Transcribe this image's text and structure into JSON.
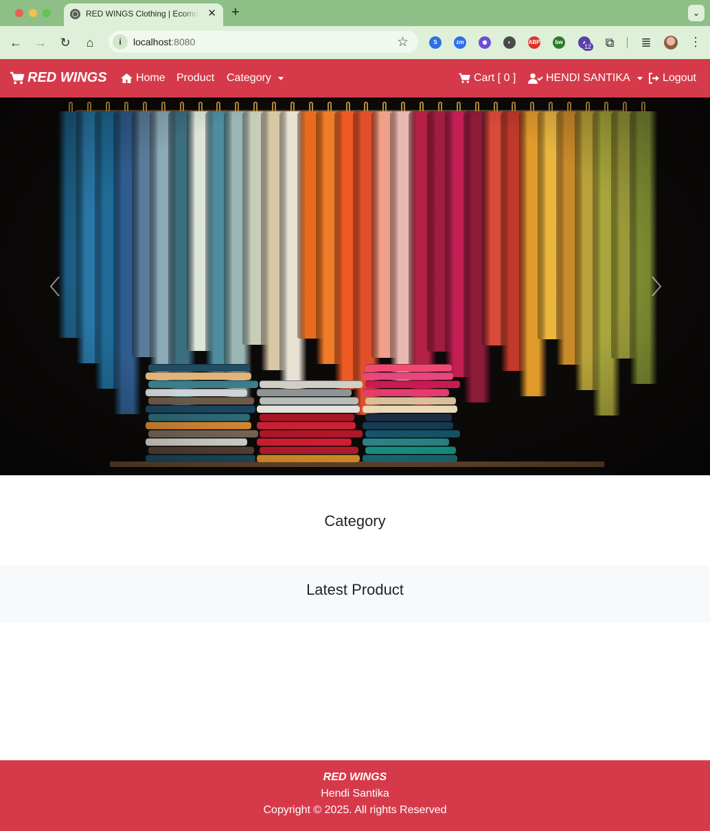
{
  "browser": {
    "tab_title": "RED WINGS Clothing | Ecommerce",
    "tab_close": "✕",
    "new_tab": "+",
    "tab_menu": "⌄",
    "url_host": "localhost",
    "url_port": ":8080",
    "extension_badge": "12",
    "extensions": [
      {
        "name": "sync-extension",
        "color": "#2f6fe0",
        "glyph": "S"
      },
      {
        "name": "zoom-extension",
        "color": "#2d6ff2",
        "glyph": "zm"
      },
      {
        "name": "color-picker-extension",
        "color": "#6b4ed6",
        "glyph": "◉"
      },
      {
        "name": "dev-extension",
        "color": "#4a4a4a",
        "glyph": "◐"
      },
      {
        "name": "adblock-extension",
        "color": "#e0302a",
        "glyph": "ABP"
      },
      {
        "name": "bw-extension",
        "color": "#2f7a2f",
        "glyph": "bw"
      },
      {
        "name": "graduation-extension",
        "color": "#5b3fa8",
        "glyph": "▲"
      }
    ]
  },
  "navbar": {
    "brand": "RED WINGS",
    "home": "Home",
    "product": "Product",
    "category": "Category",
    "cart": "Cart [ 0 ]",
    "user": "HENDI SANTIKA",
    "logout": "Logout",
    "color": "#d63a4a"
  },
  "sections": {
    "category_title": "Category",
    "latest_title": "Latest Product"
  },
  "footer": {
    "brand": "RED WINGS",
    "author": "Hendi Santika",
    "copyright": "Copyright © 2025. All rights Reserved"
  }
}
